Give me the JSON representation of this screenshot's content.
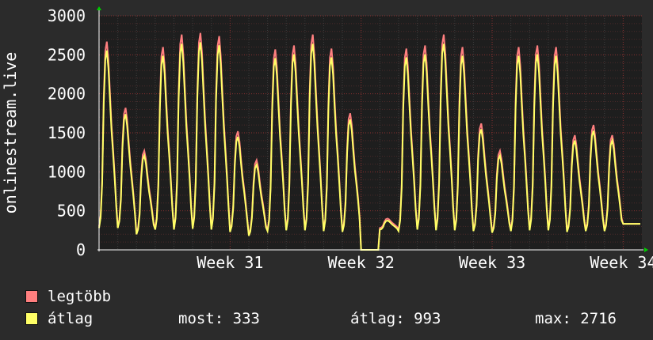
{
  "chart_data": {
    "type": "line",
    "ylabel": "onlinestream.live",
    "ylim": [
      0,
      3000
    ],
    "yticks": [
      0,
      500,
      1000,
      1500,
      2000,
      2500,
      3000
    ],
    "ytick_labels": [
      "0",
      "500",
      "1000",
      "1500",
      "2000",
      "2500",
      "3000"
    ],
    "x_domain_days": [
      0,
      29
    ],
    "xticks": [
      {
        "label": "Week 31",
        "day": 7
      },
      {
        "label": "Week 32",
        "day": 14
      },
      {
        "label": "Week 33",
        "day": 21
      },
      {
        "label": "Week 34",
        "day": 28
      }
    ],
    "grid": true,
    "daily_peaks": [
      2650,
      1800,
      1250,
      2580,
      2740,
      2760,
      2720,
      1500,
      1130,
      2550,
      2600,
      2740,
      2560,
      1730,
      0,
      380,
      2560,
      2600,
      2740,
      2580,
      1600,
      1250,
      2580,
      2600,
      2580,
      1450,
      1580,
      1450,
      333
    ],
    "daily_lows": [
      280,
      280,
      200,
      260,
      260,
      270,
      260,
      230,
      180,
      240,
      250,
      250,
      240,
      230,
      0,
      260,
      240,
      260,
      250,
      250,
      240,
      220,
      240,
      250,
      250,
      230,
      240,
      240,
      333
    ],
    "series": [
      {
        "name": "legtöbb",
        "color": "#ff7f7f"
      },
      {
        "name": "átlag",
        "color": "#ffff66"
      }
    ]
  },
  "legend": {
    "max_label": "legtöbb",
    "avg_label": "átlag",
    "max_color": "#ff7f7f",
    "avg_color": "#ffff66",
    "stats": {
      "now": "most: 333",
      "avg": "átlag: 993",
      "max": "max: 2716"
    }
  }
}
